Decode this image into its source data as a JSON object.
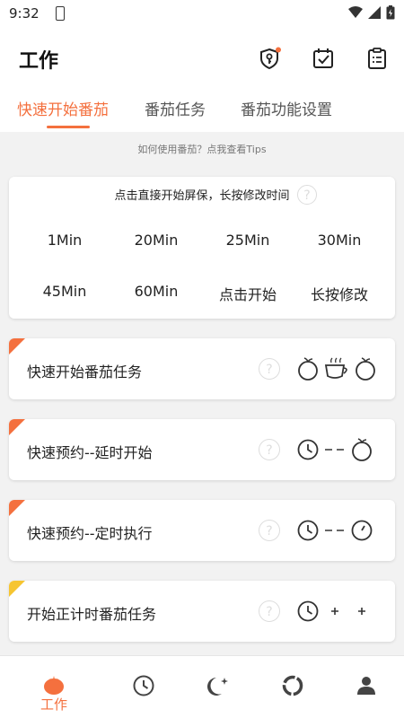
{
  "status_bar": {
    "time": "9:32"
  },
  "header": {
    "title": "工作"
  },
  "tabs": [
    {
      "label": "快速开始番茄",
      "active": true
    },
    {
      "label": "番茄任务",
      "active": false
    },
    {
      "label": "番茄功能设置",
      "active": false
    }
  ],
  "tips_text": "如何使用番茄？点我查看Tips",
  "quick_start": {
    "heading": "点击直接开始屏保，长按修改时间",
    "options": [
      "1Min",
      "20Min",
      "25Min",
      "30Min",
      "45Min",
      "60Min",
      "点击开始",
      "长按修改"
    ]
  },
  "tasks": [
    {
      "label": "快速开始番茄任务",
      "corner_color": "#f4703e"
    },
    {
      "label": "快速预约--延时开始",
      "corner_color": "#f4703e"
    },
    {
      "label": "快速预约--定时执行",
      "corner_color": "#f4703e"
    },
    {
      "label": "开始正计时番茄任务",
      "corner_color": "#f6c531"
    }
  ],
  "bottom_nav": {
    "active_label": "工作"
  },
  "colors": {
    "accent": "#f4703e",
    "yellow_tag": "#f6c531"
  },
  "help_glyph": "?"
}
